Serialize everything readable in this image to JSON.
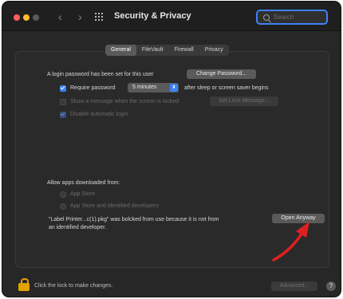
{
  "window": {
    "title": "Security & Privacy",
    "nav_back": "‹",
    "nav_forward": "›",
    "search_placeholder": "Search"
  },
  "tabs": [
    "General",
    "FileVault",
    "Firewall",
    "Privacy"
  ],
  "active_tab": "General",
  "general": {
    "login_password_text": "A login password has been set for this user",
    "change_password_label": "Change Password...",
    "require_password_label": "Require password",
    "require_password_checked": true,
    "require_password_delay": "5 minutes",
    "require_password_suffix": "after sleep or screen saver begins",
    "show_message_label": "Show a message when the screen is locked",
    "show_message_checked": false,
    "set_lock_message_label": "Set Lock Message...",
    "disable_auto_login_label": "Disable automatic login",
    "disable_auto_login_checked": true
  },
  "allow_apps": {
    "heading": "Allow apps downloaded from:",
    "options": [
      "App Store",
      "App Store and identified developers"
    ],
    "blocked_message_line1": "\"Label Printer...c(1).pkg\"  was bolcked from use because it is not from",
    "blocked_message_line2": "an identified developer.",
    "open_anyway_label": "Open Anyway"
  },
  "footer": {
    "lock_text": "Click the lock to make changes.",
    "advanced_label": "Advanced...",
    "help_label": "?"
  },
  "colors": {
    "accent": "#3b82f6",
    "annotation_arrow": "#e02020",
    "lock": "#e0a300"
  }
}
